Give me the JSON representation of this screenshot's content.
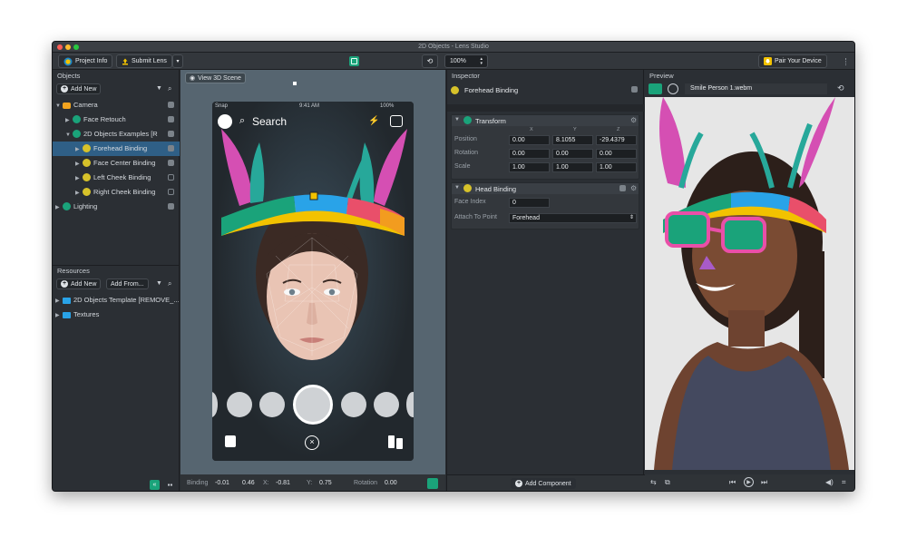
{
  "window": {
    "title": "2D Objects - Lens Studio"
  },
  "toolbar": {
    "project_info": "Project Info",
    "submit_lens": "Submit Lens",
    "zoom": "100%",
    "pair_device": "Pair Your Device"
  },
  "objects_panel": {
    "title": "Objects",
    "add_new": "Add New",
    "items": [
      {
        "label": "Camera"
      },
      {
        "label": "Face Retouch"
      },
      {
        "label": "2D Objects Examples [R"
      },
      {
        "label": "Forehead Binding"
      },
      {
        "label": "Face Center Binding"
      },
      {
        "label": "Left Cheek Binding"
      },
      {
        "label": "Right Cheek Binding"
      },
      {
        "label": "Lighting"
      }
    ]
  },
  "resources_panel": {
    "title": "Resources",
    "add_new": "Add New",
    "add_from": "Add From...",
    "items": [
      {
        "label": "2D Objects Template [REMOVE_..."
      },
      {
        "label": "Textures"
      }
    ]
  },
  "scene_panel": {
    "view_3d": "View 3D Scene",
    "phone": {
      "carrier": "Snap",
      "time": "9:41 AM",
      "battery": "100%",
      "search": "Search"
    },
    "status": {
      "binding_label": "Binding",
      "binding_value": "-0.01",
      "binding_value2": "0.46",
      "x_label": "X:",
      "x_value": "-0.81",
      "y_label": "Y:",
      "y_value": "0.75",
      "rotation_label": "Rotation",
      "rotation_value": "0.00"
    }
  },
  "inspector": {
    "title": "Inspector",
    "object_name": "Forehead Binding",
    "transform": {
      "title": "Transform",
      "axes": [
        "X",
        "Y",
        "Z"
      ],
      "position_label": "Position",
      "position": [
        "0.00",
        "8.1055",
        "-29.4379"
      ],
      "rotation_label": "Rotation",
      "rotation": [
        "0.00",
        "0.00",
        "0.00"
      ],
      "scale_label": "Scale",
      "scale": [
        "1.00",
        "1.00",
        "1.00"
      ]
    },
    "head_binding": {
      "title": "Head Binding",
      "face_index_label": "Face Index",
      "face_index": "0",
      "attach_label": "Attach To Point",
      "attach_value": "Forehead"
    },
    "add_component": "Add Component"
  },
  "preview": {
    "title": "Preview",
    "video": "Smile Person 1.webm"
  },
  "colors": {
    "window_bg": "#2a2e33",
    "panel_bg": "#2b2f34",
    "viewport_bg": "#5a6870",
    "selection": "#2f5f86",
    "accent_green": "#1aa37a",
    "accent_yellow": "#f2c200"
  }
}
